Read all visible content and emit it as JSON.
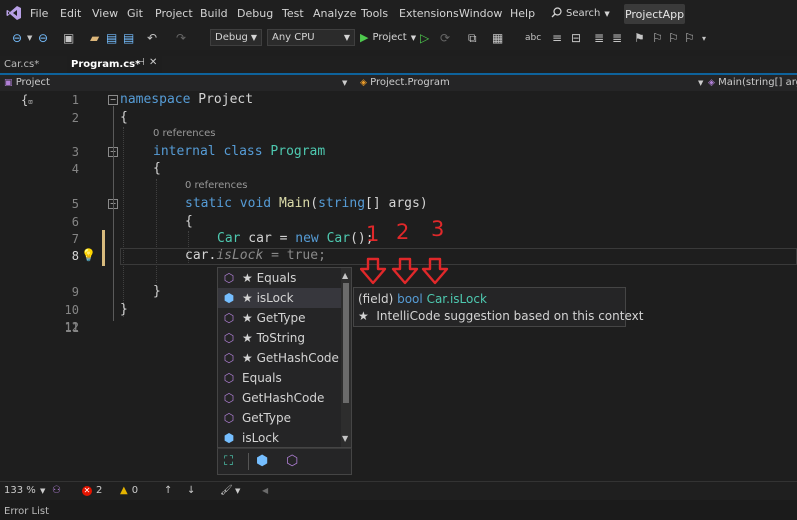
{
  "menubar": {
    "items": [
      "File",
      "Edit",
      "View",
      "Git",
      "Project",
      "Build",
      "Debug",
      "Test",
      "Analyze",
      "Tools",
      "Extensions",
      "Window",
      "Help"
    ],
    "search_label": "Search",
    "app_name": "ProjectApp"
  },
  "toolbar": {
    "config": "Debug",
    "platform": "Any CPU",
    "run_label": "Project"
  },
  "tabs": [
    {
      "label": "Car.cs*"
    },
    {
      "label": "Program.cs*"
    }
  ],
  "navbar": {
    "project": "Project",
    "class": "Project.Program",
    "member": "Main(string[] arg"
  },
  "editor": {
    "line_numbers": [
      "1",
      "2",
      "3",
      "4",
      "5",
      "6",
      "7",
      "8",
      "9",
      "10",
      "11",
      "12"
    ],
    "codelens": [
      "0 references",
      "0 references"
    ],
    "lines": {
      "l1": [
        "namespace",
        " Project"
      ],
      "l2": "{",
      "l3": [
        "internal",
        " ",
        "class",
        " ",
        "Program"
      ],
      "l4": "{",
      "l5": [
        "static",
        " ",
        "void",
        " ",
        "Main",
        "(",
        "string",
        "[] args)"
      ],
      "l6": "{",
      "l7": [
        "Car",
        " car = ",
        "new",
        " ",
        "Car",
        "();"
      ],
      "l8": [
        "car.",
        "isLock",
        " = ",
        "true",
        ";"
      ],
      "l10": "}",
      "l11": "}"
    }
  },
  "completion": {
    "items": [
      {
        "label": "★ Equals",
        "kind": "method"
      },
      {
        "label": "★ isLock",
        "kind": "field",
        "selected": true
      },
      {
        "label": "★ GetType",
        "kind": "method"
      },
      {
        "label": "★ ToString",
        "kind": "method"
      },
      {
        "label": "★ GetHashCode",
        "kind": "method"
      },
      {
        "label": "Equals",
        "kind": "method"
      },
      {
        "label": "GetHashCode",
        "kind": "method"
      },
      {
        "label": "GetType",
        "kind": "method"
      },
      {
        "label": "isLock",
        "kind": "field"
      }
    ]
  },
  "tooltip": {
    "kind": "(field)",
    "type": "bool",
    "member": "Car.isLock",
    "note": "★  IntelliCode suggestion based on this context"
  },
  "annotations": [
    "1",
    "2",
    "3"
  ],
  "statusbar": {
    "zoom": "133 %",
    "errors": "2",
    "warnings": "0"
  },
  "bottom_panel": "Error List",
  "colors": {
    "accent": "#0e639c",
    "annotation_red": "#e0282a",
    "keyword": "#569cd6",
    "type": "#4ec9b0",
    "method_icon": "#b180d7",
    "field_icon": "#75beff"
  }
}
